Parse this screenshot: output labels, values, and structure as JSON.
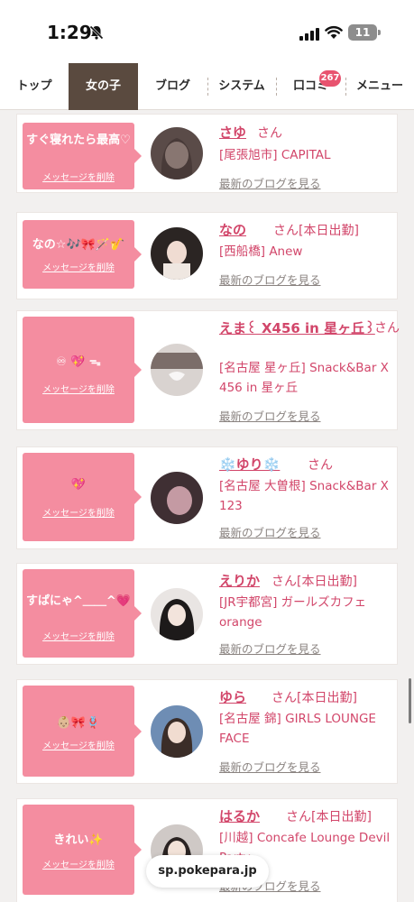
{
  "status": {
    "time": "1:29",
    "battery": "11"
  },
  "nav": {
    "tabs": [
      {
        "label": "トップ"
      },
      {
        "label": "女の子"
      },
      {
        "label": "ブログ"
      },
      {
        "label": "システム"
      },
      {
        "label": "口コミ"
      },
      {
        "label": "メニュー"
      }
    ],
    "review_badge": "267"
  },
  "cards": [
    {
      "message": "すぐ寝れたら最高♡",
      "delete_label": "メッセージを削除",
      "name": "さゆ",
      "suffix": "さん",
      "shop": "[尾張旭市] CAPITAL",
      "blog_link": "最新のブログを見る"
    },
    {
      "message": "なの☆🎶🎀🪄🎷",
      "delete_label": "メッセージを削除",
      "name": "なの",
      "suffix": "さん[本日出勤]",
      "shop": "[西船橋] Anew",
      "blog_link": "最新のブログを見る"
    },
    {
      "message": "♾ 💖 ᯓ",
      "delete_label": "メッセージを削除",
      "name": "えま꒰ X456 in 星ヶ丘꒱",
      "suffix": "さん",
      "shop": "[名古屋 星ヶ丘] Snack&Bar X 456 in 星ヶ丘",
      "blog_link": "最新のブログを見る"
    },
    {
      "message": "💖",
      "delete_label": "メッセージを削除",
      "name": "❄️ゆり❄️",
      "suffix": "さん",
      "shop": "[名古屋 大曽根] Snack&Bar X 123",
      "blog_link": "最新のブログを見る"
    },
    {
      "message": "すぱにゃ^＿＿^💗",
      "delete_label": "メッセージを削除",
      "name": "えりか",
      "suffix": "さん[本日出勤]",
      "shop": "[JR宇都宮] ガールズカフェ orange",
      "blog_link": "最新のブログを見る"
    },
    {
      "message": "👶🏼🎀🪢",
      "delete_label": "メッセージを削除",
      "name": "ゆら",
      "suffix": "さん[本日出勤]",
      "shop": "[名古屋 錦] GIRLS LOUNGE FACE",
      "blog_link": "最新のブログを見る"
    },
    {
      "message": "きれい✨",
      "delete_label": "メッセージを削除",
      "name": "はるか",
      "suffix": "さん[本日出勤]",
      "shop": "[川越] Concafe Lounge Devil Party",
      "blog_link": "最新のブログを見る"
    }
  ],
  "url_bar": {
    "domain": "sp.pokepara.jp"
  },
  "colors": {
    "accent": "#d2466a",
    "bubble": "#f48da0",
    "active_tab": "#5a4a3f",
    "badge": "#e8536f"
  },
  "icons": [
    "bell-off-icon",
    "cellular-signal-icon",
    "wifi-icon",
    "battery-icon"
  ]
}
